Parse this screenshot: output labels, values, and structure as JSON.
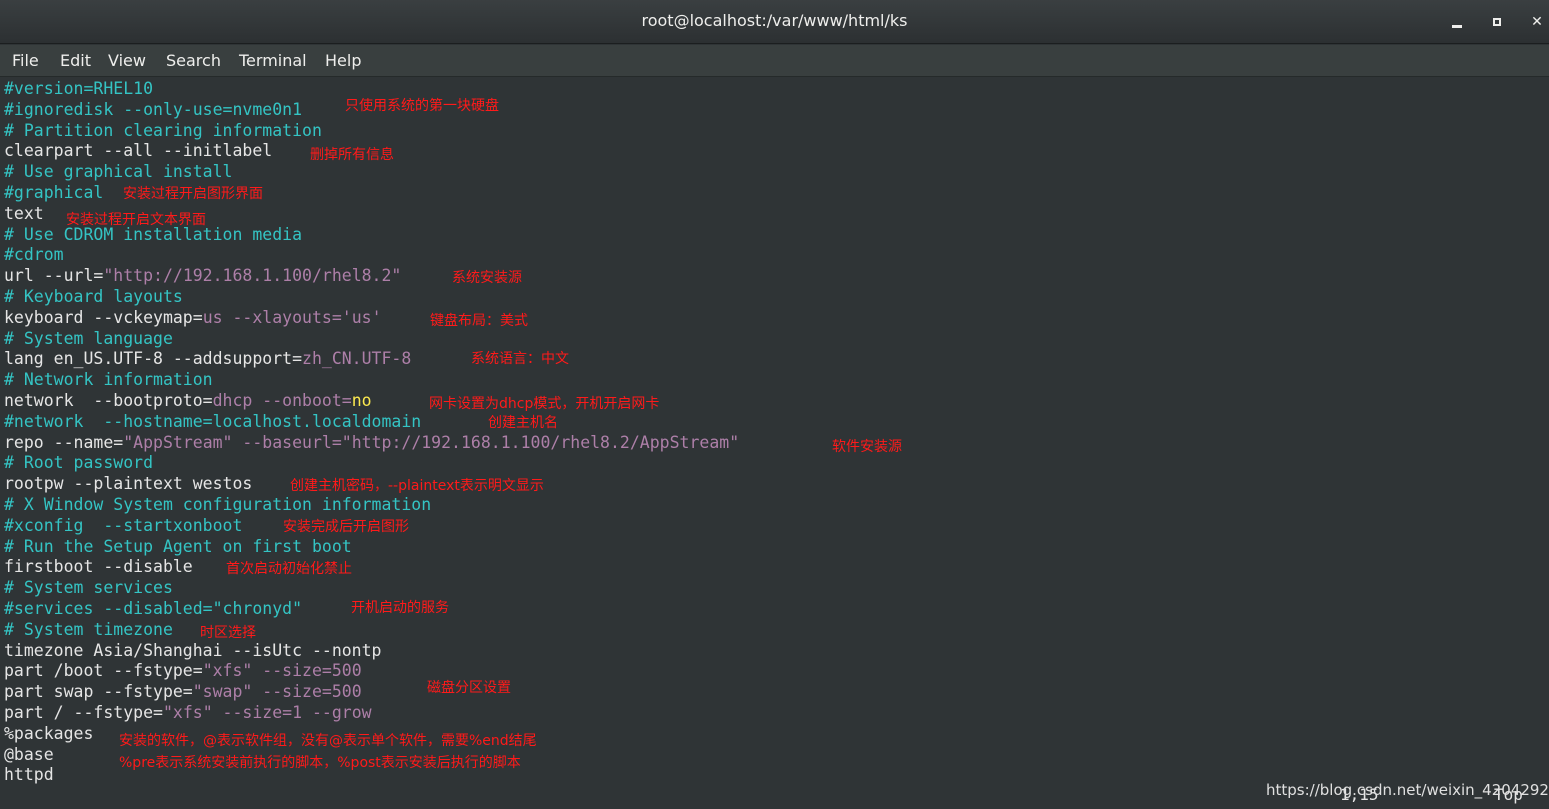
{
  "window": {
    "title": "root@localhost:/var/www/html/ks",
    "min": "",
    "max": "",
    "close": "✕"
  },
  "menu": [
    "File",
    "Edit",
    "View",
    "Search",
    "Terminal",
    "Help"
  ],
  "colors": {
    "comment": "#34c4c4",
    "string": "#ad7fa8",
    "keyword_yellow": "#fce94f",
    "annotation": "#ff1a1a",
    "background": "#2f3436",
    "text": "#e5e5e5"
  },
  "lines": {
    "l1": "#version=RHEL10",
    "l2": "#ignoredisk --only-use=nvme0n1",
    "l3": "# Partition clearing information",
    "l4": "clearpart --all --initlabel",
    "l5": "# Use graphical install",
    "l6": "#graphical",
    "l7": "text",
    "l8": "# Use CDROM installation media",
    "l9": "#cdrom",
    "l10a": "url --url=",
    "l10b": "\"http://192.168.1.100/rhel8.2\"",
    "l11": "# Keyboard layouts",
    "l12a": "keyboard --vckeymap=",
    "l12b": "us",
    "l12c": " --xlayouts=",
    "l12d": "'us'",
    "l13": "# System language",
    "l14a": "lang en_US.UTF-8 --addsupport=",
    "l14b": "zh_CN.UTF-8",
    "l15": "# Network information",
    "l16a": "network  --bootproto=",
    "l16b": "dhcp",
    "l16c": " --onboot=",
    "l16d": "no",
    "l17": "#network  --hostname=localhost.localdomain",
    "l18a": "repo --name=",
    "l18b": "\"AppStream\"",
    "l18c": " --baseurl=",
    "l18d": "\"http://192.168.1.100/rhel8.2/AppStream\"",
    "l19": "# Root password",
    "l20": "rootpw --plaintext westos",
    "l21": "# X Window System configuration information",
    "l22": "#xconfig  --startxonboot",
    "l23": "# Run the Setup Agent on first boot",
    "l24": "firstboot --disable",
    "l25": "# System services",
    "l26": "#services --disabled=\"chronyd\"",
    "l27": "# System timezone",
    "l28": "timezone Asia/Shanghai --isUtc --nontp",
    "l29a": "part /boot --fstype=",
    "l29b": "\"xfs\"",
    "l29c": " --size=500",
    "l30a": "part swap --fstype=",
    "l30b": "\"swap\"",
    "l30c": " --size=500",
    "l31a": "part / --fstype=",
    "l31b": "\"xfs\"",
    "l31c": " --size=1 --grow",
    "l32": "%packages",
    "l33": "@base",
    "l34": "httpd"
  },
  "annotations": {
    "a2": "只使用系统的第一块硬盘",
    "a4": "删掉所有信息",
    "a6": "安装过程开启图形界面",
    "a7": "安装过程开启文本界面",
    "a10": "系统安装源",
    "a12": "键盘布局：美式",
    "a14": "系统语言：中文",
    "a16": "网卡设置为dhcp模式，开机开启网卡",
    "a17": "创建主机名",
    "a18": "软件安装源",
    "a20": "创建主机密码，--plaintext表示明文显示",
    "a22": "安装完成后开启图形",
    "a24": "首次启动初始化禁止",
    "a26": "开机启动的服务",
    "a27": "时区选择",
    "a29": "磁盘分区设置",
    "a32": "安装的软件，@表示软件组，没有@表示单个软件，需要%end结尾",
    "a33": "%pre表示系统安装前执行的脚本，%post表示安装后执行的脚本"
  },
  "status": {
    "position": "1,15",
    "scroll": "Top"
  },
  "watermark": "https://blog.csdn.net/weixin_42042926"
}
